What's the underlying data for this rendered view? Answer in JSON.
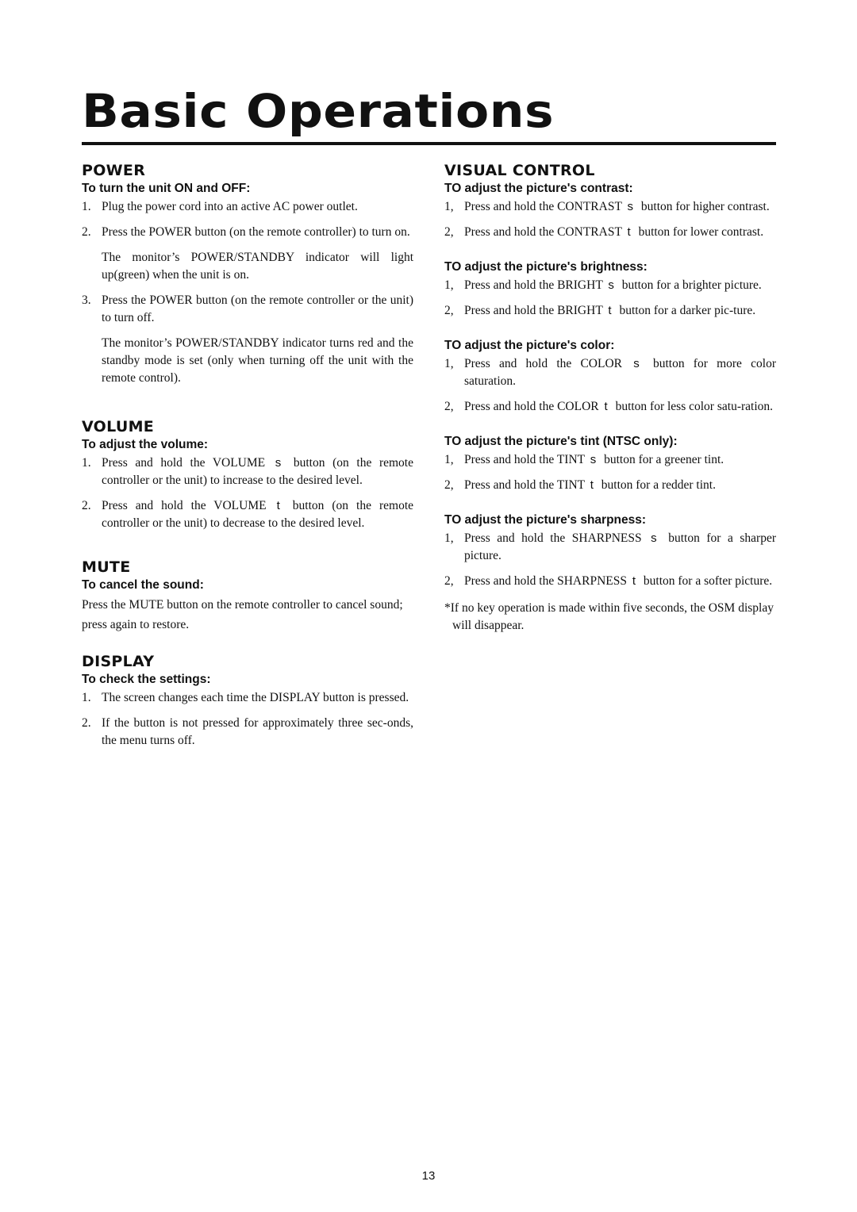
{
  "page": {
    "title": "Basic Operations",
    "page_number": "13"
  },
  "left": {
    "power": {
      "heading": "POWER",
      "subheading": "To turn the unit ON and OFF:",
      "steps": [
        {
          "num": "1.",
          "text": "Plug the power cord into an active AC power outlet."
        },
        {
          "num": "2.",
          "text": "Press the POWER button (on the remote controller) to turn on."
        },
        {
          "num": "3.",
          "text": "Press the POWER button (on the remote controller or the unit) to turn off."
        }
      ],
      "note_after_2": "The monitor’s POWER/STANDBY indicator will light up(green) when the unit is on.",
      "note_after_3": "The monitor’s POWER/STANDBY indicator turns red and the standby mode is set (only when turning off the unit with the remote control)."
    },
    "volume": {
      "heading": "VOLUME",
      "subheading": "To adjust the volume:",
      "steps": [
        {
          "num": "1.",
          "pre": "Press and hold the VOLUME",
          "arrow": "s",
          "post": "button (on the remote controller or the unit) to increase to the desired level."
        },
        {
          "num": "2.",
          "pre": "Press and hold the VOLUME",
          "arrow": "t",
          "post": "button (on the remote controller or the unit) to decrease  to the desired level."
        }
      ]
    },
    "mute": {
      "heading": "MUTE",
      "subheading": "To cancel the sound:",
      "text": "Press the MUTE button on the remote controller to cancel sound; press again to restore."
    },
    "display": {
      "heading": "DISPLAY",
      "subheading": "To check the settings:",
      "steps": [
        {
          "num": "1.",
          "text": "The screen changes each time the DISPLAY button is pressed."
        },
        {
          "num": "2.",
          "text": "If the button is not pressed for approximately three sec-onds, the menu turns off."
        }
      ]
    }
  },
  "right": {
    "heading": "VISUAL CONTROL",
    "groups": [
      {
        "subheading": "TO adjust the picture's contrast:",
        "steps": [
          {
            "num": "1,",
            "pre": "Press and hold the CONTRAST",
            "arrow": "s",
            "post": "button for higher contrast."
          },
          {
            "num": "2,",
            "pre": "Press and hold the CONTRAST",
            "arrow": "t",
            "post": "button for lower contrast."
          }
        ]
      },
      {
        "subheading": "TO adjust the picture's brightness:",
        "steps": [
          {
            "num": "1,",
            "pre": "Press and hold the BRIGHT",
            "arrow": "s",
            "post": "button for a brighter picture."
          },
          {
            "num": "2,",
            "pre": "Press and hold the BRIGHT",
            "arrow": "t",
            "post": "button for a darker pic-ture."
          }
        ]
      },
      {
        "subheading": "TO adjust the picture's color:",
        "steps": [
          {
            "num": "1,",
            "pre": "Press and hold the COLOR",
            "arrow": "s",
            "post": "button for more color saturation."
          },
          {
            "num": "2,",
            "pre": "Press and hold the COLOR",
            "arrow": "t",
            "post": "button for less color satu-ration."
          }
        ]
      },
      {
        "subheading": "TO adjust the picture's tint (NTSC only):",
        "steps": [
          {
            "num": "1,",
            "pre": "Press and hold the TINT",
            "arrow": "s",
            "post": "button for a greener tint."
          },
          {
            "num": "2,",
            "pre": "Press and hold the TINT",
            "arrow": "t",
            "post": "button for a redder tint."
          }
        ]
      },
      {
        "subheading": "TO adjust the picture's sharpness:",
        "steps": [
          {
            "num": "1,",
            "pre": "Press and hold the SHARPNESS",
            "arrow": "s",
            "post": "button for a sharper picture."
          },
          {
            "num": "2,",
            "pre": "Press and hold the SHARPNESS",
            "arrow": "t",
            "post": "button for a softer picture."
          }
        ]
      }
    ],
    "footnote": "*If no key operation is made within five seconds, the OSM display will disappear."
  }
}
